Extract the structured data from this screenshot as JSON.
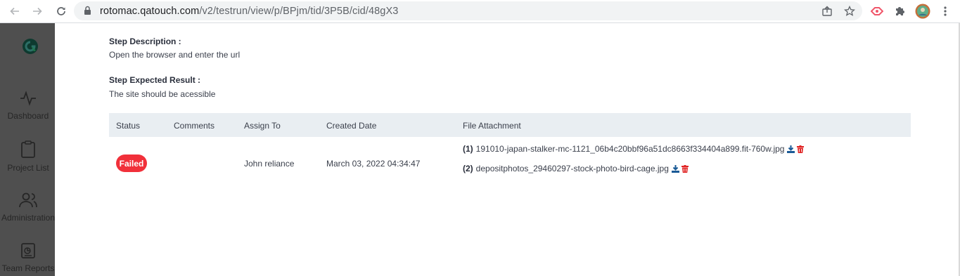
{
  "browser": {
    "url_host": "rotomac.qatouch.com",
    "url_path": "/v2/testrun/view/p/BPjm/tid/3P5B/cid/48gX3",
    "icons": [
      "back-icon",
      "forward-icon",
      "reload-icon",
      "lock-icon",
      "share-icon",
      "star-icon",
      "extension-red-icon",
      "puzzle-icon",
      "profile-avatar",
      "menu-icon"
    ]
  },
  "sidebar": {
    "items": [
      {
        "label": "Dashboard",
        "icon": "activity-icon"
      },
      {
        "label": "Project List",
        "icon": "clipboard-icon"
      },
      {
        "label": "Administration",
        "icon": "users-icon"
      },
      {
        "label": "Team Reports",
        "icon": "report-icon"
      }
    ]
  },
  "step": {
    "description_label": "Step Description :",
    "description": "Open the browser and enter the url",
    "expected_label": "Step Expected Result :",
    "expected": "The site should be acessible"
  },
  "table": {
    "headers": {
      "status": "Status",
      "comments": "Comments",
      "assign_to": "Assign To",
      "created_date": "Created Date",
      "file_attachment": "File Attachment"
    },
    "row": {
      "status": "Failed",
      "comments": "",
      "assign_to": "John reliance",
      "created_date": "March 03, 2022 04:34:47",
      "files": [
        {
          "num": "(1)",
          "name": "191010-japan-stalker-mc-1121_06b4c20bbf96a51dc8663f334404a899.fit-760w.jpg"
        },
        {
          "num": "(2)",
          "name": "depositphotos_29460297-stock-photo-bird-cage.jpg"
        }
      ]
    }
  },
  "colors": {
    "failed_badge": "#f1303a",
    "download_icon": "#1a5a96",
    "delete_icon": "#e02424",
    "table_header_bg": "#e9eef2",
    "sidebar_bg": "#4f4f4f"
  }
}
